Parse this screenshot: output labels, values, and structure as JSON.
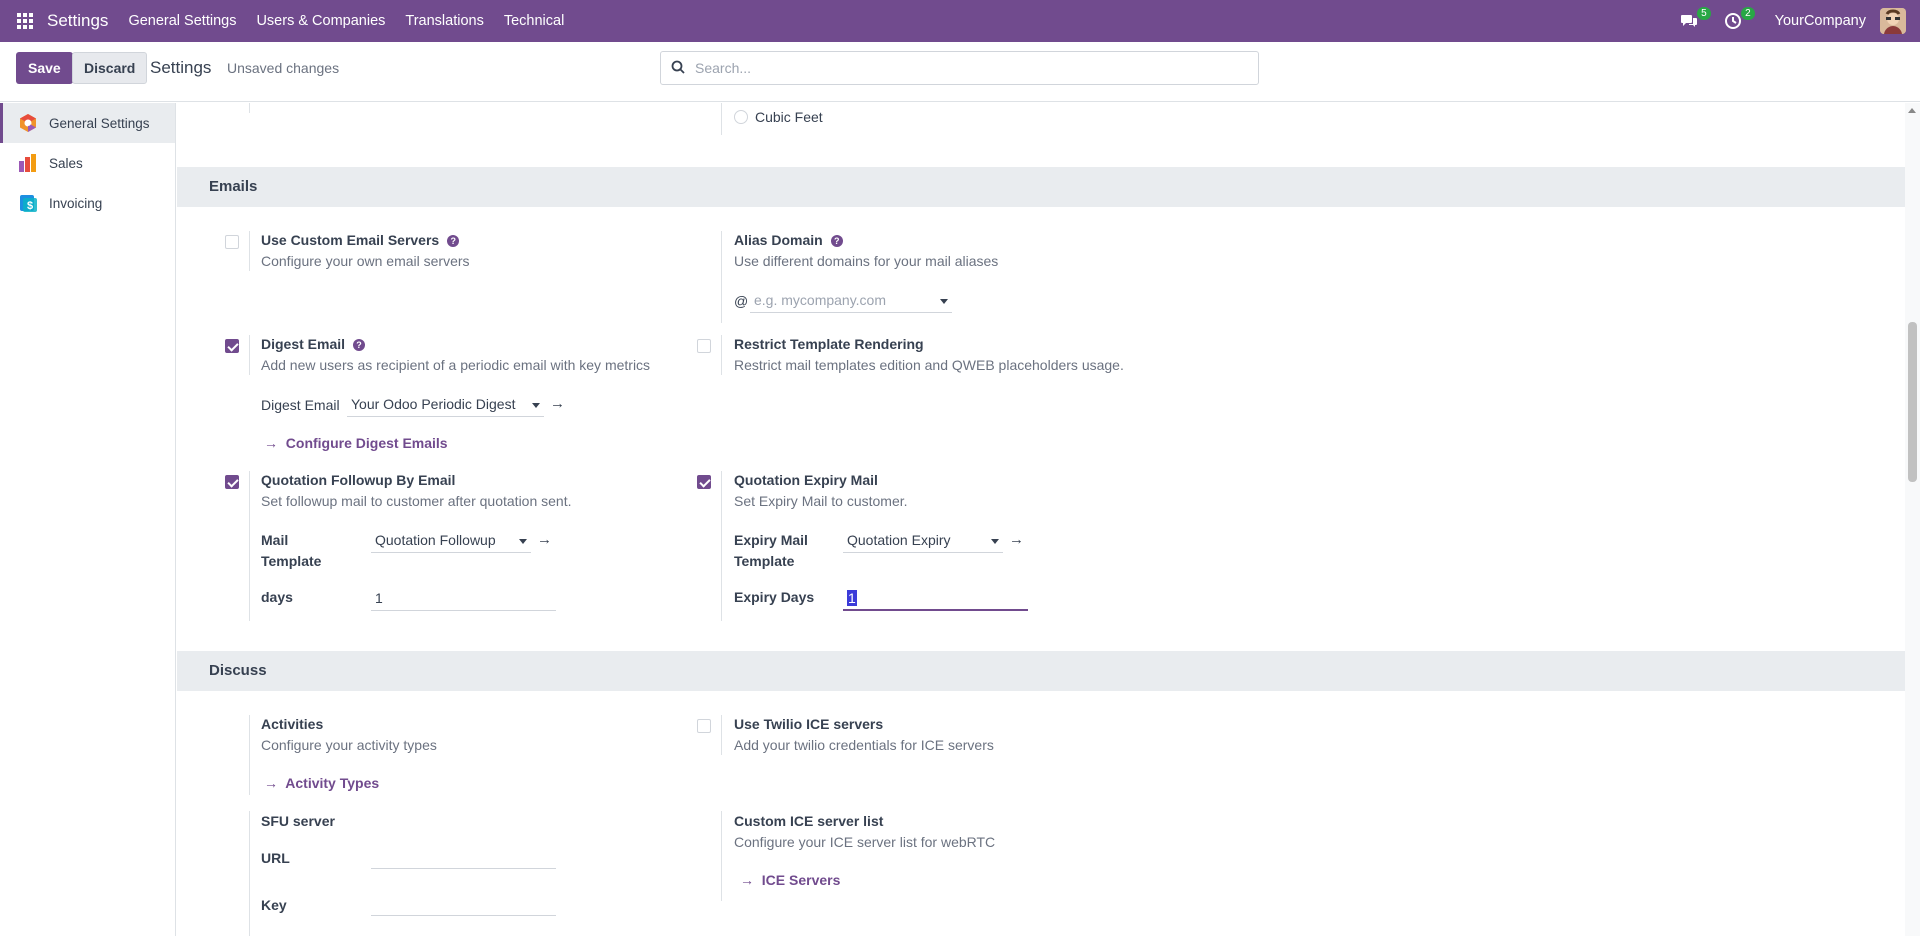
{
  "navbar": {
    "brand": "Settings",
    "menu": [
      "General Settings",
      "Users & Companies",
      "Translations",
      "Technical"
    ],
    "messages_count": "5",
    "activities_count": "2",
    "company": "YourCompany"
  },
  "control": {
    "save_label": "Save",
    "discard_label": "Discard",
    "title": "Settings",
    "status": "Unsaved changes",
    "search_placeholder": "Search..."
  },
  "sidebar": {
    "items": [
      {
        "label": "General Settings",
        "active": true
      },
      {
        "label": "Sales",
        "active": false
      },
      {
        "label": "Invoicing",
        "active": false
      }
    ]
  },
  "units": {
    "cubic_feet": "Cubic Feet"
  },
  "emails": {
    "header": "Emails",
    "custom_servers": {
      "title": "Use Custom Email Servers",
      "desc": "Configure your own email servers",
      "checked": false
    },
    "alias_domain": {
      "title": "Alias Domain",
      "desc": "Use different domains for your mail aliases",
      "at": "@",
      "placeholder": "e.g. mycompany.com"
    },
    "digest": {
      "title": "Digest Email",
      "desc": "Add new users as recipient of a periodic email with key metrics",
      "checked": true,
      "field_label": "Digest Email",
      "field_value": "Your Odoo Periodic Digest",
      "link": "Configure Digest Emails"
    },
    "restrict": {
      "title": "Restrict Template Rendering",
      "desc": "Restrict mail templates edition and QWEB placeholders usage.",
      "checked": false
    },
    "followup": {
      "title": "Quotation Followup By Email",
      "desc": "Set followup mail to customer after quotation sent.",
      "checked": true,
      "template_label_1": "Mail",
      "template_label_2": "Template",
      "template_value": "Quotation Followup",
      "days_label": "days",
      "days_value": "1"
    },
    "expiry": {
      "title": "Quotation Expiry Mail",
      "desc": "Set Expiry Mail to customer.",
      "checked": true,
      "template_label_1": "Expiry Mail",
      "template_label_2": "Template",
      "template_value": "Quotation Expiry",
      "days_label": "Expiry Days",
      "days_value": "1"
    }
  },
  "discuss": {
    "header": "Discuss",
    "activities": {
      "title": "Activities",
      "desc": "Configure your activity types",
      "link": "Activity Types"
    },
    "twilio": {
      "title": "Use Twilio ICE servers",
      "desc": "Add your twilio credentials for ICE servers",
      "checked": false
    },
    "sfu": {
      "title": "SFU server",
      "url_label": "URL",
      "key_label": "Key"
    },
    "ice_list": {
      "title": "Custom ICE server list",
      "desc": "Configure your ICE server list for webRTC",
      "link": "ICE Servers"
    }
  },
  "colors": {
    "brand": "#714b8e",
    "badge": "#28a745"
  }
}
